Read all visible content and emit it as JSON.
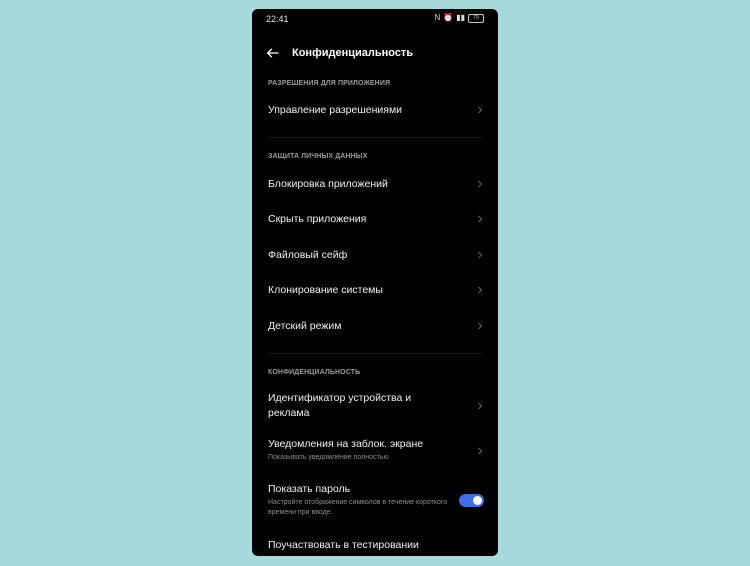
{
  "status_bar": {
    "time": "22:41",
    "nfc": "N",
    "alarm": "⏰",
    "signal": "▮▮",
    "battery": "79"
  },
  "header": {
    "title": "Конфиденциальность"
  },
  "sections": {
    "app_permissions": "РАЗРЕШЕНИЯ ДЛЯ ПРИЛОЖЕНИЯ",
    "data_protection": "ЗАЩИТА ЛИЧНЫХ ДАННЫХ",
    "privacy": "КОНФИДЕНЦИАЛЬНОСТЬ"
  },
  "items": {
    "permissions": "Управление разрешениями",
    "app_lock": "Блокировка приложений",
    "hide_apps": "Скрыть приложения",
    "file_safe": "Файловый сейф",
    "system_clone": "Клонирование системы",
    "kids_mode": "Детский режим",
    "device_id": "Идентификатор устройства и реклама",
    "lockscreen_notif": "Уведомления на заблок. экране",
    "lockscreen_notif_sub": "Показывать уведомление полностью",
    "show_password": "Показать пароль",
    "show_password_sub": "Настройте отображение символов в течение короткого времени при вводе.",
    "beta": "Поучаствовать в тестировании"
  },
  "toggles": {
    "show_password_on": true
  },
  "colors": {
    "background": "#a8d9dd",
    "phone": "#000000",
    "accent": "#3f6fe8"
  }
}
